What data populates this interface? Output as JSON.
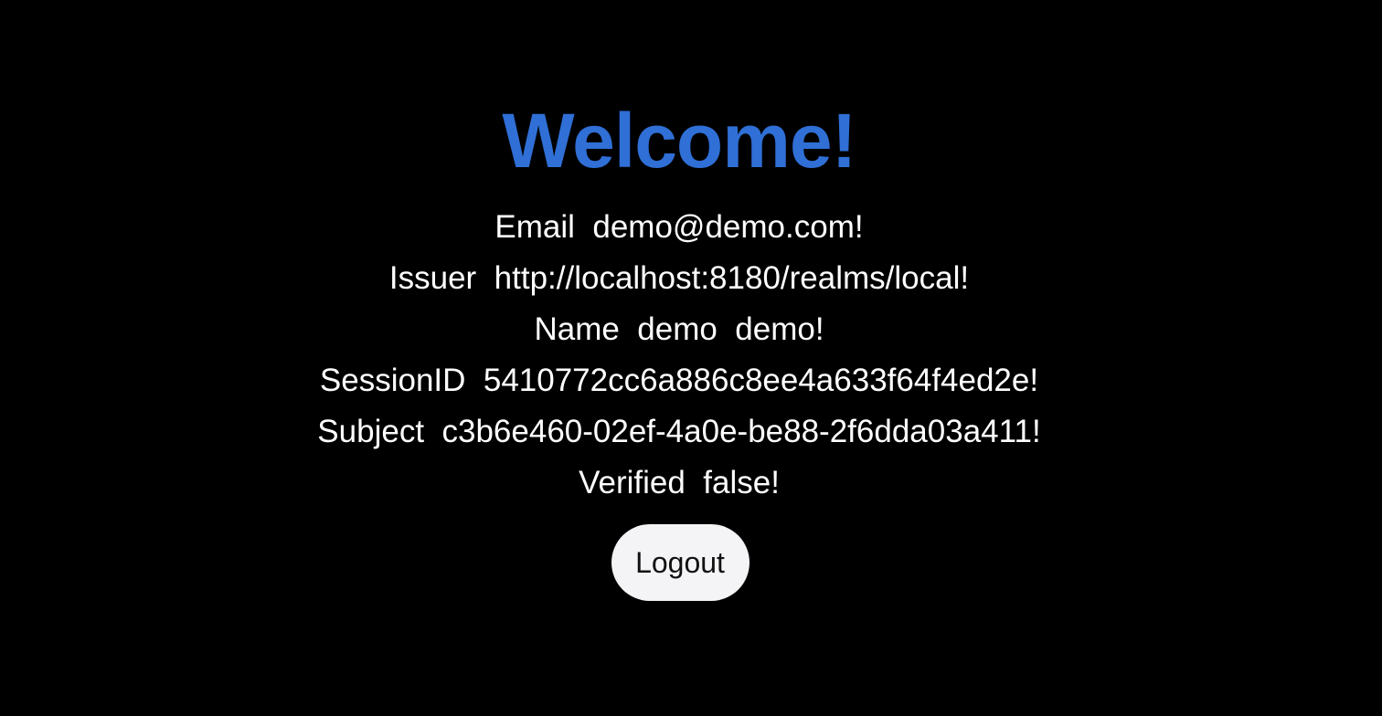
{
  "heading": "Welcome!",
  "colors": {
    "background": "#000000",
    "heading": "#2f6fd6",
    "text": "#ffffff",
    "button_bg": "#f4f4f6",
    "button_text": "#111111"
  },
  "info": {
    "email": "Email  demo@demo.com!",
    "issuer": "Issuer  http://localhost:8180/realms/local!",
    "name": "Name  demo  demo!",
    "session_id": "SessionID  5410772cc6a886c8ee4a633f64f4ed2e!",
    "subject": "Subject  c3b6e460-02ef-4a0e-be88-2f6dda03a411!",
    "verified": "Verified  false!"
  },
  "logout_label": "Logout"
}
